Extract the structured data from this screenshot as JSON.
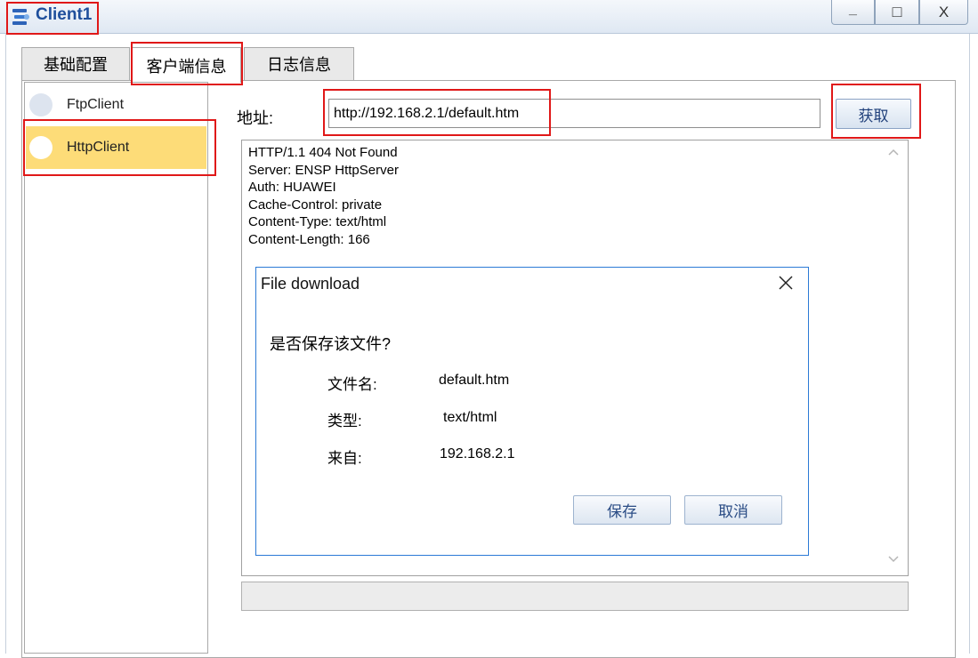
{
  "window": {
    "title": "Client1",
    "minimize_glyph": "_",
    "maximize_glyph": "□",
    "close_glyph": "X"
  },
  "tabs": [
    {
      "label": "基础配置",
      "selected": false
    },
    {
      "label": "客户端信息",
      "selected": true
    },
    {
      "label": "日志信息",
      "selected": false
    }
  ],
  "client_list": [
    {
      "label": "FtpClient",
      "selected": false
    },
    {
      "label": "HttpClient",
      "selected": true
    }
  ],
  "address": {
    "label": "地址:",
    "value": "http://192.168.2.1/default.htm"
  },
  "get_button": "获取",
  "response_lines": [
    "HTTP/1.1 404 Not Found",
    "Server: ENSP HttpServer",
    "Auth: HUAWEI",
    "Cache-Control: private",
    "Content-Type: text/html",
    "Content-Length: 166"
  ],
  "dialog": {
    "title": "File download",
    "question": "是否保存该文件?",
    "filename_label": "文件名:",
    "filename_value": "default.htm",
    "type_label": "类型:",
    "type_value": "text/html",
    "from_label": "来自:",
    "from_value": "192.168.2.1",
    "save_button": "保存",
    "cancel_button": "取消"
  },
  "colors": {
    "title_text": "#1f4f9c",
    "highlight_annotation": "#e01818",
    "selected_item_bg": "#fddc78",
    "dialog_border": "#2c7ad6"
  },
  "icons": {
    "app": "client-app-icon",
    "dialog_close": "close-icon",
    "scroll_up": "chevron-up-icon",
    "scroll_down": "chevron-down-icon"
  }
}
